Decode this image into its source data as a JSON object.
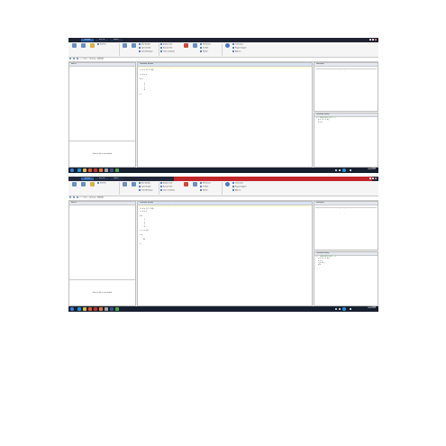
{
  "screenshots": [
    {
      "window_tabs": [
        "HOME",
        "PLOTS",
        "APPS"
      ],
      "ribbon": {
        "buttons": [
          "New Script",
          "New",
          "Open",
          "Find Files",
          "Import Data",
          "Save Workspace",
          "Simulink",
          "Layout",
          "Help"
        ],
        "small_items": [
          "New Variable",
          "Open Variable",
          "Clear Workspace",
          "Analyze Code",
          "Run and Time",
          "Clear Commands",
          "Preferences",
          "Set Path",
          "Parallel",
          "Community",
          "Request Support",
          "Add-Ons"
        ]
      },
      "address_bar": "C: > Users > Desktop > MATLAB",
      "current_folder": {
        "header": "Name ▴",
        "empty_message": "Select a file to view details"
      },
      "command_window": {
        "header": "Command Window",
        "notice": "New to MATLAB? See resources for Getting Started.",
        "lines": [
          ">> a = [1 2 3 4];",
          "",
          ">> b = a'",
          "",
          "b =",
          "",
          "     1",
          "     2",
          "     3",
          "     4",
          "",
          ">> "
        ]
      },
      "workspace": {
        "header": "Workspace",
        "columns": [
          "Name ▴",
          "Value",
          "Min",
          "Max"
        ],
        "rows": [
          [
            "a",
            "[1,2,3,4]",
            "1",
            "4"
          ],
          [
            "b",
            "[1;2;3;4]",
            "1",
            "4"
          ]
        ]
      },
      "history": {
        "header": "Command History",
        "lines": [
          "%-- 14/05/2015 10:31 --%",
          "a = [1 2 3 4];",
          "b = a'"
        ]
      },
      "taskbar": {
        "time": "10:32",
        "date": "14/05/2015"
      }
    },
    {
      "window_tabs": [
        "HOME",
        "PLOTS",
        "APPS"
      ],
      "ribbon": {
        "buttons": [
          "New Script",
          "New",
          "Open",
          "Find Files",
          "Import Data",
          "Save Workspace",
          "Simulink",
          "Layout",
          "Help"
        ],
        "small_items": [
          "New Variable",
          "Open Variable",
          "Clear Workspace",
          "Analyze Code",
          "Run and Time",
          "Clear Commands",
          "Preferences",
          "Set Path",
          "Parallel",
          "Community",
          "Request Support",
          "Add-Ons"
        ]
      },
      "address_bar": "C: > Users > Desktop > MATLAB",
      "current_folder": {
        "header": "Name ▴",
        "empty_message": "Select a file to view details"
      },
      "command_window": {
        "header": "Command Window",
        "notice": "New to MATLAB? See resources for Getting Started.",
        "lines": [
          ">> a = [1 2 3 4];",
          ">> b = a'",
          "",
          "b =",
          "",
          "     1",
          "     2",
          "     3",
          "     4",
          "",
          ">> c = a*b",
          "",
          "c =",
          "",
          "    30",
          "",
          ">> "
        ]
      },
      "workspace": {
        "header": "Workspace",
        "columns": [
          "Name ▴",
          "Value",
          "Min",
          "Max"
        ],
        "rows": [
          [
            "a",
            "[1,2,3,4]",
            "1",
            "4"
          ],
          [
            "ans",
            "30",
            "30",
            "30"
          ],
          [
            "b",
            "[1;2;3;4]",
            "1",
            "4"
          ],
          [
            "c",
            "30",
            "30",
            "30"
          ]
        ]
      },
      "history": {
        "header": "Command History",
        "lines": [
          "%-- 14/05/2015 10:31 --%",
          "a = [1 2 3 4];",
          "b = a'",
          "c = a*b",
          "a*b"
        ]
      },
      "taskbar": {
        "time": "10:34",
        "date": "14/05/2015"
      }
    }
  ]
}
